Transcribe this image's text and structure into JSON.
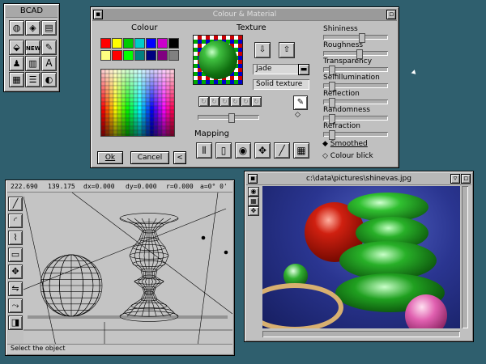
{
  "bcad": {
    "title": "BCAD",
    "tools": [
      "globe-icon",
      "cube-icon",
      "paint-icon",
      "bucket-icon",
      "new-icon",
      "pen-icon",
      "figure-icon",
      "chart-icon",
      "text-icon",
      "calc-icon",
      "layers-icon",
      "render-icon",
      "table-icon"
    ],
    "new_label": "NEW",
    "text_tool_label": "A"
  },
  "colour_window": {
    "title": "Colour & Material",
    "colour_heading": "Colour",
    "texture_heading": "Texture",
    "texture_name": "Jade",
    "texture_type": "Solid texture",
    "mapping_heading": "Mapping",
    "ok_label": "Ok",
    "cancel_label": "Cancel",
    "back_label": "<",
    "sliders": [
      {
        "label": "Shininess",
        "value": 0.6
      },
      {
        "label": "Roughness",
        "value": 0.55
      },
      {
        "label": "Transparency",
        "value": 0.1
      },
      {
        "label": "Selfillumination",
        "value": 0.1
      },
      {
        "label": "Reflection",
        "value": 0.1
      },
      {
        "label": "Randomness",
        "value": 0.1
      },
      {
        "label": "Refraction",
        "value": 0.1
      }
    ],
    "radio_smoothed": "Smoothed",
    "radio_colour_blick": "Colour blick",
    "palette_colors": [
      "#ff0000",
      "#ffff00",
      "#00cc00",
      "#00cccc",
      "#0000ff",
      "#cc00cc",
      "#000000",
      "#ffff80",
      "#ff0000",
      "#00ff00",
      "#008080",
      "#000080",
      "#800080",
      "#808080"
    ]
  },
  "cad_window": {
    "readout": {
      "x": "222.690",
      "y": "139.175",
      "dx": "dx=0.000",
      "dy": "dy=0.000",
      "r": "r=0.000",
      "a": "a=0° 0'"
    },
    "status": "Select the object",
    "tools": [
      "line-icon",
      "arc-icon",
      "polyline-icon",
      "rect-icon",
      "move-icon",
      "mirror-icon",
      "bend-icon",
      "shade-icon"
    ]
  },
  "image_window": {
    "title": "c:\\data\\pictures\\shinevas.jpg",
    "tools": [
      "view-icon",
      "grid-icon",
      "move-icon"
    ]
  }
}
